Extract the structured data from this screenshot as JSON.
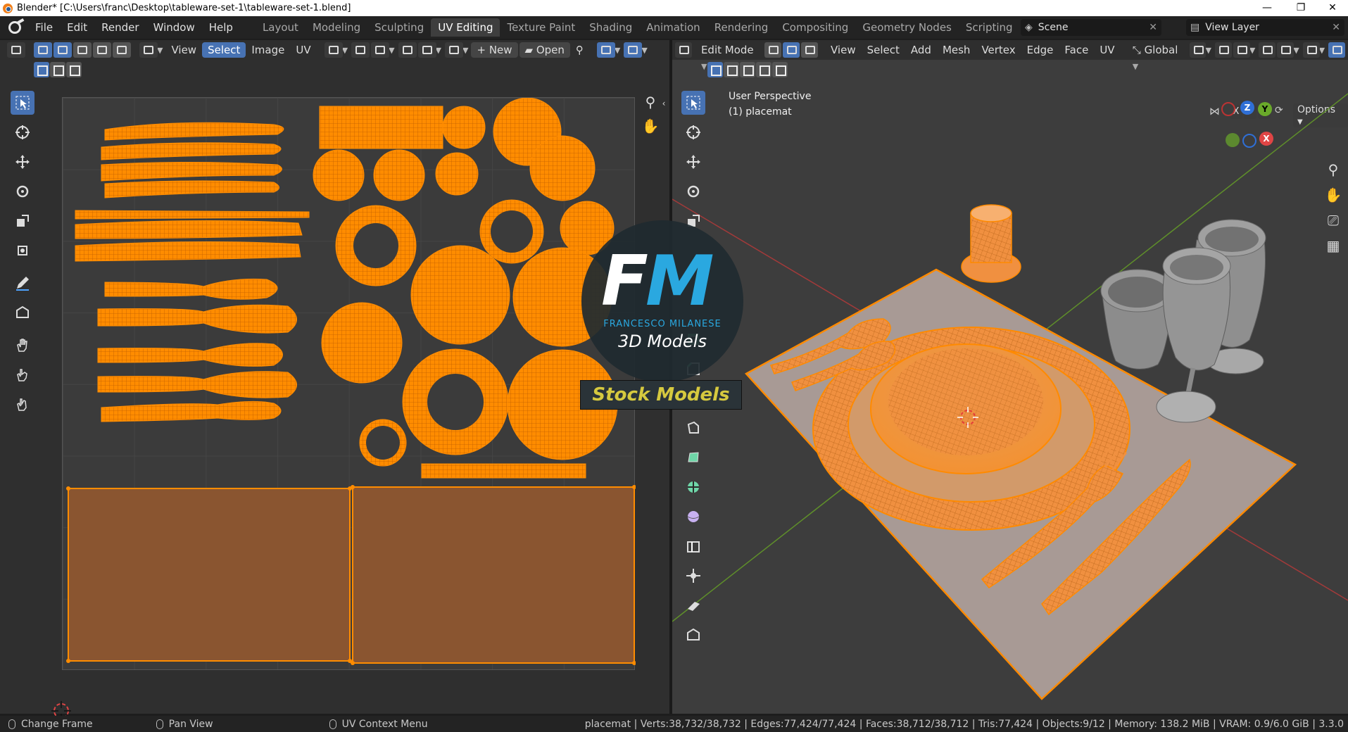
{
  "window": {
    "title": "Blender* [C:\\Users\\franc\\Desktop\\tableware-set-1\\tableware-set-1.blend]",
    "minimize": "—",
    "maximize": "❐",
    "close": "✕"
  },
  "menu": {
    "items": [
      "File",
      "Edit",
      "Render",
      "Window",
      "Help"
    ]
  },
  "workspaces": {
    "tabs": [
      "Layout",
      "Modeling",
      "Sculpting",
      "UV Editing",
      "Texture Paint",
      "Shading",
      "Animation",
      "Rendering",
      "Compositing",
      "Geometry Nodes",
      "Scripting"
    ],
    "active": "UV Editing",
    "add": "+"
  },
  "scene": {
    "label": "Scene"
  },
  "view_layer": {
    "label": "View Layer"
  },
  "uv_editor": {
    "header": {
      "view": "View",
      "select": "Select",
      "image": "Image",
      "uv": "UV",
      "new": "New",
      "open": "Open"
    }
  },
  "viewport": {
    "header": {
      "mode": "Edit Mode",
      "view": "View",
      "select": "Select",
      "add": "Add",
      "mesh": "Mesh",
      "vertex": "Vertex",
      "edge": "Edge",
      "face": "Face",
      "uv": "UV",
      "orientation": "Global",
      "options": "Options"
    },
    "axis_toggles": [
      "X",
      "Y",
      "Z"
    ],
    "overlay": {
      "perspective": "User Perspective",
      "object": "(1) placemat"
    },
    "gizmo": {
      "z": "Z",
      "y": "Y",
      "x": "X"
    }
  },
  "watermark": {
    "f": "F",
    "m": "M",
    "name": "FRANCESCO MILANESE",
    "sub": "3D Models",
    "badge": "Stock Models"
  },
  "status": {
    "left1": "Change Frame",
    "left2": "Pan View",
    "left3": "UV Context Menu",
    "stats": "placemat | Verts:38,732/38,732 | Edges:77,424/77,424 | Faces:38,712/38,712 | Tris:77,424 | Objects:9/12 | Memory: 138.2 MiB | VRAM: 0.9/6.0 GiB | 3.3.0"
  },
  "colors": {
    "accent": "#4772b3",
    "selection": "#ff8a00",
    "uv_face": "#8a5530"
  }
}
